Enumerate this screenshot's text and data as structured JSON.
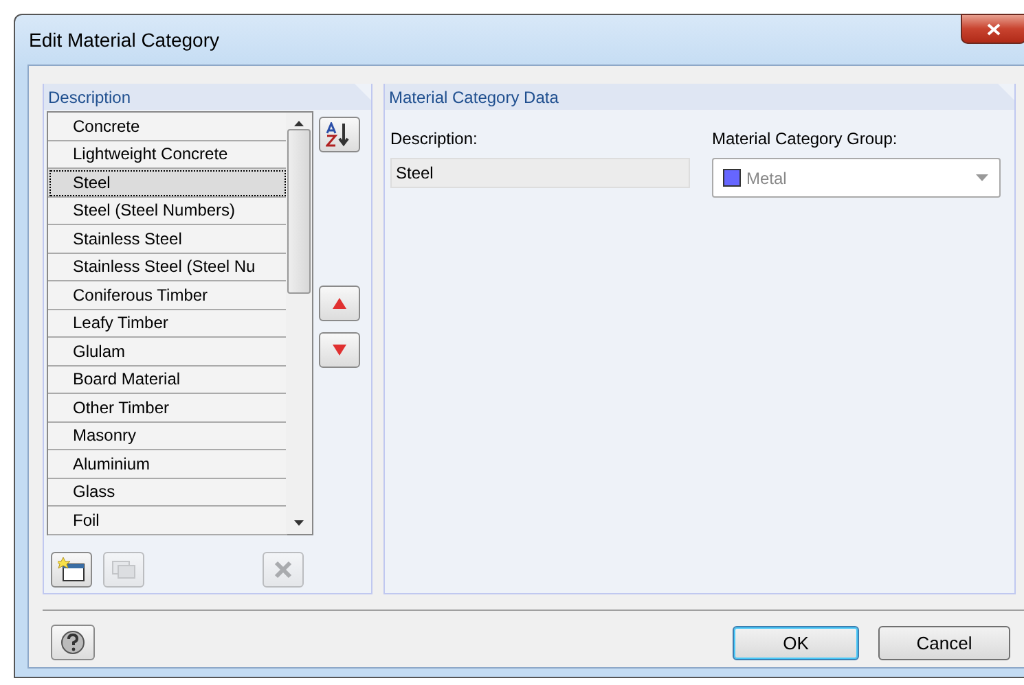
{
  "window": {
    "title": "Edit Material Category"
  },
  "list_panel": {
    "title": "Description",
    "items": [
      {
        "label": "Concrete",
        "selected": false
      },
      {
        "label": "Lightweight Concrete",
        "selected": false
      },
      {
        "label": "Steel",
        "selected": true
      },
      {
        "label": "Steel (Steel Numbers)",
        "selected": false
      },
      {
        "label": "Stainless Steel",
        "selected": false
      },
      {
        "label": "Stainless Steel (Steel Nu",
        "selected": false
      },
      {
        "label": "Coniferous Timber",
        "selected": false
      },
      {
        "label": "Leafy Timber",
        "selected": false
      },
      {
        "label": "Glulam",
        "selected": false
      },
      {
        "label": "Board Material",
        "selected": false
      },
      {
        "label": "Other Timber",
        "selected": false
      },
      {
        "label": "Masonry",
        "selected": false
      },
      {
        "label": "Aluminium",
        "selected": false
      },
      {
        "label": "Glass",
        "selected": false
      },
      {
        "label": "Foil",
        "selected": false
      }
    ],
    "tools": [
      {
        "kind": "new",
        "disabled": false
      },
      {
        "kind": "copy",
        "disabled": true
      },
      {
        "kind": "delete",
        "disabled": true
      }
    ]
  },
  "data_panel": {
    "title": "Material Category Data",
    "description_label": "Description:",
    "description_value": "Steel",
    "group_label": "Material Category Group:",
    "group": {
      "label": "Metal",
      "color": "#6666ff",
      "disabled": true
    }
  },
  "buttons": [
    {
      "label": "OK",
      "default": true
    },
    {
      "label": "Cancel",
      "default": false
    }
  ]
}
